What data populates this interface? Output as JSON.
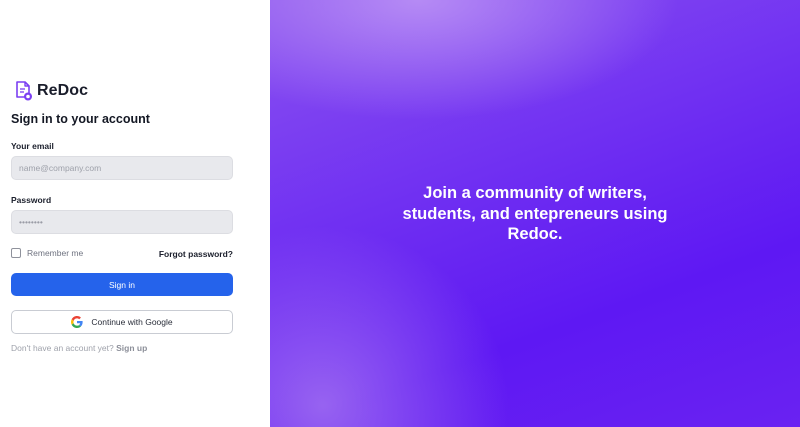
{
  "brand": {
    "name": "ReDoc",
    "accent": "#6d2cf2",
    "icon": "document-logo-icon"
  },
  "form": {
    "title": "Sign in to your account",
    "email_label": "Your email",
    "email_placeholder": "name@company.com",
    "email_value": "",
    "password_label": "Password",
    "password_value": "password",
    "remember_label": "Remember me",
    "remember_checked": false,
    "forgot_label": "Forgot password?",
    "signin_label": "Sign in",
    "signin_color": "#2563eb",
    "google_label": "Continue with Google",
    "google_icon": "google-icon",
    "no_account_text": "Don't have an account yet?",
    "signup_label": "Sign up"
  },
  "hero": {
    "lines": [
      "Join a community of writers,",
      "students, and entepreneurs using",
      "Redoc."
    ],
    "gradient": [
      "#8a52f0",
      "#6d2cf2",
      "#5e18f3"
    ]
  }
}
